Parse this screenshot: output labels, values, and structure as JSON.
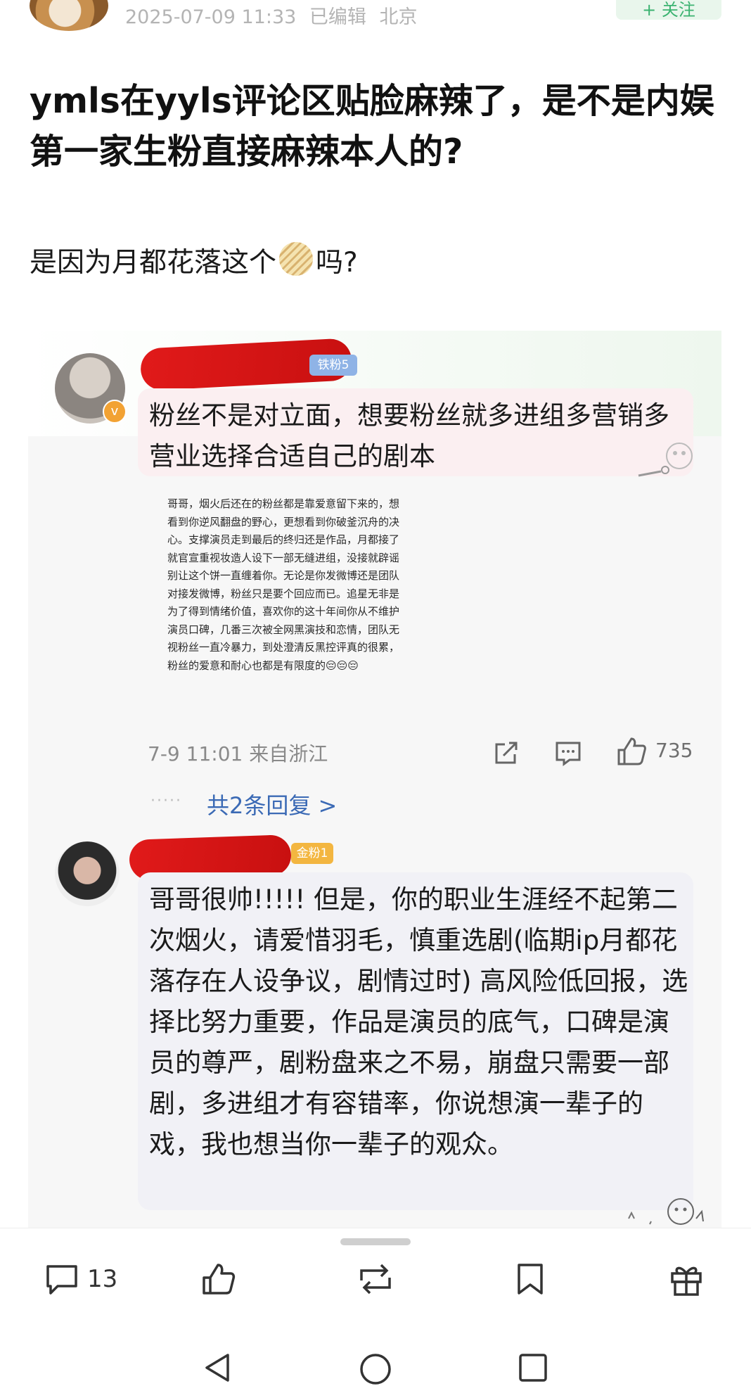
{
  "header": {
    "date": "2025-07-09 11:33",
    "edited": "已编辑",
    "location": "北京",
    "follow_label": "+ 关注"
  },
  "post": {
    "title": "ymls在yyls评论区贴脸麻辣了，是不是内娱第一家生粉直接麻辣本人的?",
    "body_before": "是因为月都花落这个",
    "body_after": "吗?",
    "inline_emoji": "grid-biscuit-emoji"
  },
  "screenshot": {
    "comment1": {
      "badge": "铁粉5",
      "verified_icon": "v",
      "text": "粉丝不是对立面，想要粉丝就多进组多营销多营业选择合适自己的剧本",
      "image_text": "哥哥，烟火后还在的粉丝都是靠爱意留下来的，想看到你逆风翻盘的野心，更想看到你破釜沉舟的决心。支撑演员走到最后的终归还是作品，月都接了就官宣重视妆造人设下一部无缝进组，没接就辟谣别让这个饼一直缠着你。无论是你发微博还是团队对接发微博，粉丝只是要个回应而已。追星无非是为了得到情绪价值，喜欢你的这十年间你从不维护演员口碑，几番三次被全网黑演技和恋情，团队无视粉丝一直冷暴力，到处澄清反黑控评真的很累，粉丝的爱意和耐心也都是有限度的😔😔😔",
      "time": "7-9 11:01",
      "source": "来自浙江",
      "likes": "735",
      "replies_dots": "·····",
      "replies_link": "共2条回复 >"
    },
    "comment2": {
      "badge": "金粉1",
      "text": "哥哥很帅!!!!! 但是，你的职业生涯经不起第二次烟火，请爱惜羽毛，慎重选剧(临期ip月都花落存在人设争议，剧情过时) 高风险低回报，选择比努力重要，作品是演员的底气，口碑是演员的尊严，剧粉盘来之不易，崩盘只需要一部剧，多进组才有容错率，你说想演一辈子的戏，我也想当你一辈子的观众。"
    }
  },
  "bottom_bar": {
    "comment_count": "13",
    "icons": [
      "comment-icon",
      "like-icon",
      "repost-icon",
      "bookmark-icon",
      "gift-icon"
    ]
  },
  "system_nav": [
    "back-icon",
    "home-icon",
    "recents-icon"
  ],
  "colors": {
    "link": "#3b6ab5",
    "follow_green": "#3cb371",
    "redaction": "#d81818",
    "bubble1": "#fbeff1",
    "bubble2": "#f1f1f6"
  }
}
